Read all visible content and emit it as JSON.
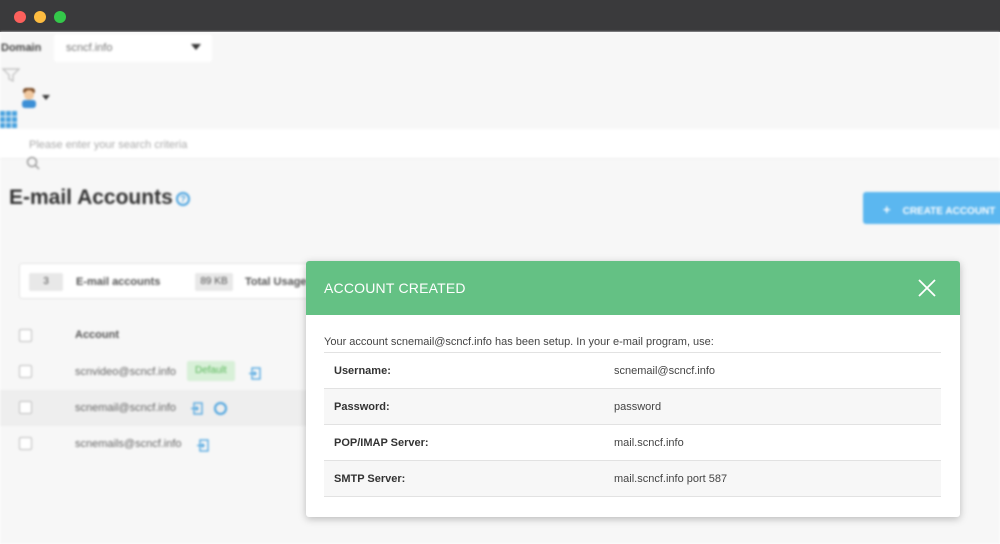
{
  "window": {
    "traffic_lights": [
      "close",
      "minimize",
      "maximize"
    ]
  },
  "domain": {
    "label": "Domain",
    "value": "scncf.info"
  },
  "search": {
    "placeholder": "Please enter your search criteria"
  },
  "page": {
    "title": "E-mail Accounts",
    "create_button": "CREATE ACCOUNT"
  },
  "stats": {
    "accounts_count": "3",
    "accounts_label": "E-mail accounts",
    "usage_value": "89 KB",
    "usage_label": "Total Usage"
  },
  "table": {
    "column_account": "Account",
    "rows": [
      {
        "account": "scnvideo@scncf.info",
        "badge": "Default"
      },
      {
        "account": "scnemail@scncf.info"
      },
      {
        "account": "scnemails@scncf.info"
      }
    ]
  },
  "modal": {
    "title": "ACCOUNT CREATED",
    "message": "Your account scnemail@scncf.info has been setup. In your e-mail program, use:",
    "fields": [
      {
        "label": "Username:",
        "value": "scnemail@scncf.info"
      },
      {
        "label": "Password:",
        "value": "password"
      },
      {
        "label": "POP/IMAP Server:",
        "value": "mail.scncf.info"
      },
      {
        "label": "SMTP Server:",
        "value": "mail.scncf.info port 587"
      }
    ]
  },
  "colors": {
    "modal_header": "#64c184",
    "accent_blue": "#5bb7f0",
    "titlebar": "#3a3a3c"
  }
}
